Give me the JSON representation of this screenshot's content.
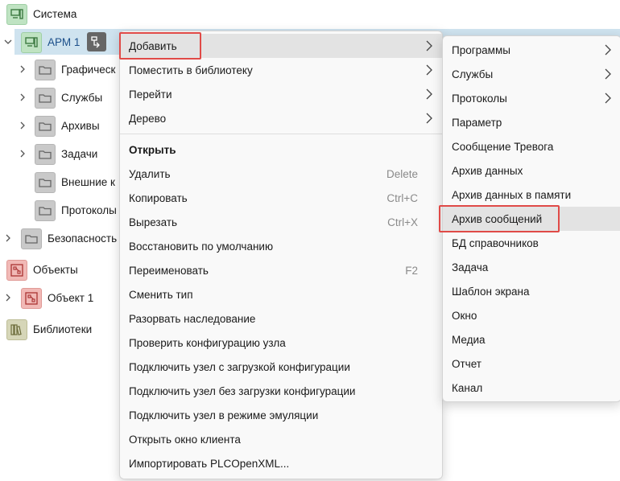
{
  "tree": {
    "sistema": "Система",
    "arm1": "АРМ 1",
    "graficheskie": "Графическ",
    "sluzhby": "Службы",
    "arhivy": "Архивы",
    "zadachi": "Задачи",
    "vneshnie": "Внешние к",
    "protokoly": "Протоколы",
    "bezopasnost": "Безопасность",
    "obekty": "Объекты",
    "obekt1": "Объект 1",
    "biblioteki": "Библиотеки"
  },
  "context_menu": {
    "items": [
      {
        "label": "Добавить",
        "shortcut": "",
        "submenu": true
      },
      {
        "label": "Поместить в библиотеку",
        "shortcut": "",
        "submenu": true
      },
      {
        "label": "Перейти",
        "shortcut": "",
        "submenu": true
      },
      {
        "label": "Дерево",
        "shortcut": "",
        "submenu": true
      },
      {
        "label": "Открыть",
        "shortcut": "",
        "submenu": false
      },
      {
        "label": "Удалить",
        "shortcut": "Delete",
        "submenu": false
      },
      {
        "label": "Копировать",
        "shortcut": "Ctrl+C",
        "submenu": false
      },
      {
        "label": "Вырезать",
        "shortcut": "Ctrl+X",
        "submenu": false
      },
      {
        "label": "Восстановить по умолчанию",
        "shortcut": "",
        "submenu": false
      },
      {
        "label": "Переименовать",
        "shortcut": "F2",
        "submenu": false
      },
      {
        "label": "Сменить тип",
        "shortcut": "",
        "submenu": false
      },
      {
        "label": "Разорвать наследование",
        "shortcut": "",
        "submenu": false
      },
      {
        "label": "Проверить конфигурацию узла",
        "shortcut": "",
        "submenu": false
      },
      {
        "label": "Подключить узел с загрузкой конфигурации",
        "shortcut": "",
        "submenu": false
      },
      {
        "label": "Подключить узел без загрузки конфигурации",
        "shortcut": "",
        "submenu": false
      },
      {
        "label": "Подключить узел в режиме эмуляции",
        "shortcut": "",
        "submenu": false
      },
      {
        "label": "Открыть окно клиента",
        "shortcut": "",
        "submenu": false
      },
      {
        "label": "Импортировать PLCOpenXML...",
        "shortcut": "",
        "submenu": false
      }
    ]
  },
  "submenu": {
    "items": [
      {
        "label": "Программы",
        "submenu": true
      },
      {
        "label": "Службы",
        "submenu": true
      },
      {
        "label": "Протоколы",
        "submenu": true
      },
      {
        "label": "Параметр",
        "submenu": false
      },
      {
        "label": "Сообщение Тревога",
        "submenu": false
      },
      {
        "label": "Архив данных",
        "submenu": false
      },
      {
        "label": "Архив данных в памяти",
        "submenu": false
      },
      {
        "label": "Архив сообщений",
        "submenu": false
      },
      {
        "label": "БД справочников",
        "submenu": false
      },
      {
        "label": "Задача",
        "submenu": false
      },
      {
        "label": "Шаблон экрана",
        "submenu": false
      },
      {
        "label": "Окно",
        "submenu": false
      },
      {
        "label": "Медиа",
        "submenu": false
      },
      {
        "label": "Отчет",
        "submenu": false
      },
      {
        "label": "Канал",
        "submenu": false
      }
    ]
  },
  "colors": {
    "highlight_box": "#e04a47",
    "selection": "#cfe3ef",
    "hover": "#e3e3e3"
  }
}
